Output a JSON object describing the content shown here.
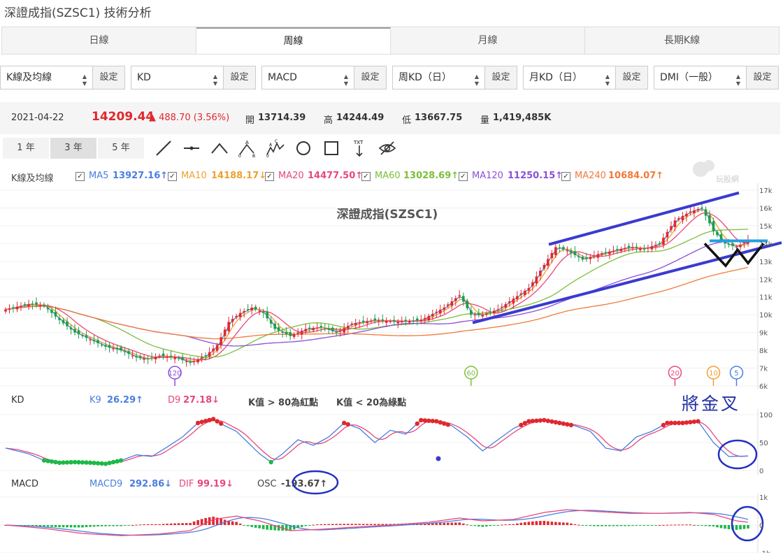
{
  "page_title": "深證成指(SZSC1) 技術分析",
  "tabs": [
    "日線",
    "周線",
    "月線",
    "長期K線"
  ],
  "active_tab": 1,
  "selects": [
    {
      "label": "K線及均線",
      "button": "設定"
    },
    {
      "label": "KD",
      "button": "設定"
    },
    {
      "label": "MACD",
      "button": "設定"
    },
    {
      "label": "周KD（日）",
      "button": "設定"
    },
    {
      "label": "月KD（日）",
      "button": "設定"
    },
    {
      "label": "DMI（一般）",
      "button": "設定"
    }
  ],
  "quote": {
    "date": "2021-04-22",
    "price": "14209.44",
    "change": "▲ 488.70 (3.56%)",
    "open_label": "開",
    "open": "13714.39",
    "high_label": "高",
    "high": "14244.49",
    "low_label": "低",
    "low": "13667.75",
    "vol_label": "量",
    "vol": "1,419,485K"
  },
  "ranges": [
    "1 年",
    "3 年",
    "5 年"
  ],
  "active_range": 1,
  "tool_labels": {
    "a": "A",
    "b": "B",
    "c": "C",
    "zero": "0",
    "txt": "TXT"
  },
  "price_legend": {
    "name": "K線及均線",
    "items": [
      {
        "label": "MA5",
        "value": "13927.16↑",
        "color": "#4a7ee0"
      },
      {
        "label": "MA10",
        "value": "14188.17↓",
        "color": "#f0a030"
      },
      {
        "label": "MA20",
        "value": "14477.50↑",
        "color": "#e8487a"
      },
      {
        "label": "MA60",
        "value": "13028.69↑",
        "color": "#7cbf3a"
      },
      {
        "label": "MA120",
        "value": "11250.15↑",
        "color": "#8a50d8"
      },
      {
        "label": "MA240",
        "value": "10684.07↑",
        "color": "#f07a3a"
      }
    ]
  },
  "kd_legend": {
    "name": "KD",
    "k_label": "K9",
    "k_value": "26.29↑",
    "d_label": "D9",
    "d_value": "27.18↓",
    "note1": "K值 > 80為紅點",
    "note2": "K值 < 20為綠點"
  },
  "macd_legend": {
    "name": "MACD",
    "macd_label": "MACD9",
    "macd_value": "292.86↓",
    "dif_label": "DIF",
    "dif_value": "99.19↓",
    "osc_label": "OSC",
    "osc_value": "-193.67↑"
  },
  "watermark": "玩股網",
  "annotation_text": "將金叉",
  "colors": {
    "up": "#e0282e",
    "down": "#1e9e48",
    "trend": "#3a3ad0",
    "cyan": "#21a0e0"
  },
  "chart_data": [
    {
      "type": "candlestick",
      "title": "深證成指(SZSC1)",
      "ylim": [
        6000,
        17000
      ],
      "yticks": [
        "17k",
        "16k",
        "15k",
        "14k",
        "13k",
        "12k",
        "11k",
        "10k",
        "9k",
        "8k",
        "7k",
        "6k"
      ],
      "ma_markers": [
        "120",
        "60",
        "20",
        "10",
        "5"
      ],
      "anchors": [
        [
          0,
          10300
        ],
        [
          6,
          10600
        ],
        [
          10,
          10500
        ],
        [
          14,
          9700
        ],
        [
          18,
          9000
        ],
        [
          22,
          8600
        ],
        [
          26,
          8200
        ],
        [
          30,
          8000
        ],
        [
          34,
          7600
        ],
        [
          37,
          7500
        ],
        [
          40,
          7700
        ],
        [
          44,
          7600
        ],
        [
          48,
          7300
        ],
        [
          52,
          7700
        ],
        [
          55,
          8300
        ],
        [
          58,
          9600
        ],
        [
          61,
          10100
        ],
        [
          64,
          10400
        ],
        [
          67,
          10100
        ],
        [
          70,
          9200
        ],
        [
          74,
          8800
        ],
        [
          78,
          9200
        ],
        [
          82,
          9300
        ],
        [
          86,
          9000
        ],
        [
          90,
          9500
        ],
        [
          96,
          9700
        ],
        [
          102,
          9600
        ],
        [
          108,
          9700
        ],
        [
          114,
          10400
        ],
        [
          118,
          11100
        ],
        [
          121,
          10000
        ],
        [
          124,
          10000
        ],
        [
          128,
          10300
        ],
        [
          132,
          10900
        ],
        [
          136,
          11500
        ],
        [
          140,
          12800
        ],
        [
          143,
          13800
        ],
        [
          146,
          13600
        ],
        [
          150,
          13100
        ],
        [
          154,
          13400
        ],
        [
          158,
          13600
        ],
        [
          162,
          13800
        ],
        [
          166,
          13700
        ],
        [
          170,
          14000
        ],
        [
          174,
          15300
        ],
        [
          178,
          15800
        ],
        [
          181,
          16000
        ],
        [
          184,
          14700
        ],
        [
          187,
          14000
        ],
        [
          190,
          13800
        ],
        [
          193,
          14200
        ]
      ]
    },
    {
      "type": "line",
      "name": "KD",
      "ylim": [
        0,
        100
      ],
      "yticks": [
        "100",
        "50",
        "0"
      ],
      "k_anchors": [
        [
          0,
          40
        ],
        [
          6,
          30
        ],
        [
          10,
          18
        ],
        [
          14,
          14
        ],
        [
          18,
          15
        ],
        [
          22,
          14
        ],
        [
          26,
          12
        ],
        [
          30,
          18
        ],
        [
          34,
          28
        ],
        [
          38,
          25
        ],
        [
          42,
          42
        ],
        [
          46,
          60
        ],
        [
          50,
          85
        ],
        [
          54,
          92
        ],
        [
          57,
          80
        ],
        [
          60,
          70
        ],
        [
          63,
          50
        ],
        [
          66,
          30
        ],
        [
          69,
          15
        ],
        [
          72,
          30
        ],
        [
          76,
          55
        ],
        [
          80,
          45
        ],
        [
          84,
          60
        ],
        [
          88,
          85
        ],
        [
          92,
          75
        ],
        [
          96,
          50
        ],
        [
          100,
          72
        ],
        [
          104,
          65
        ],
        [
          108,
          90
        ],
        [
          112,
          88
        ],
        [
          116,
          80
        ],
        [
          120,
          60
        ],
        [
          124,
          35
        ],
        [
          128,
          55
        ],
        [
          132,
          75
        ],
        [
          136,
          88
        ],
        [
          140,
          90
        ],
        [
          144,
          85
        ],
        [
          148,
          80
        ],
        [
          152,
          70
        ],
        [
          156,
          40
        ],
        [
          160,
          35
        ],
        [
          164,
          60
        ],
        [
          168,
          70
        ],
        [
          172,
          85
        ],
        [
          176,
          85
        ],
        [
          180,
          88
        ],
        [
          184,
          50
        ],
        [
          188,
          25
        ],
        [
          193,
          26
        ]
      ]
    },
    {
      "type": "bar",
      "name": "MACD",
      "yticks": [
        "1k",
        "0",
        "-1k"
      ],
      "dif_anchors": [
        [
          0,
          0
        ],
        [
          10,
          -120
        ],
        [
          20,
          -300
        ],
        [
          30,
          -380
        ],
        [
          40,
          -320
        ],
        [
          48,
          -200
        ],
        [
          54,
          200
        ],
        [
          60,
          320
        ],
        [
          66,
          150
        ],
        [
          74,
          -200
        ],
        [
          82,
          -150
        ],
        [
          90,
          -80
        ],
        [
          100,
          0
        ],
        [
          110,
          100
        ],
        [
          118,
          250
        ],
        [
          124,
          150
        ],
        [
          132,
          200
        ],
        [
          140,
          450
        ],
        [
          146,
          550
        ],
        [
          154,
          480
        ],
        [
          162,
          420
        ],
        [
          170,
          420
        ],
        [
          178,
          450
        ],
        [
          184,
          380
        ],
        [
          190,
          150
        ],
        [
          193,
          99
        ]
      ]
    }
  ]
}
